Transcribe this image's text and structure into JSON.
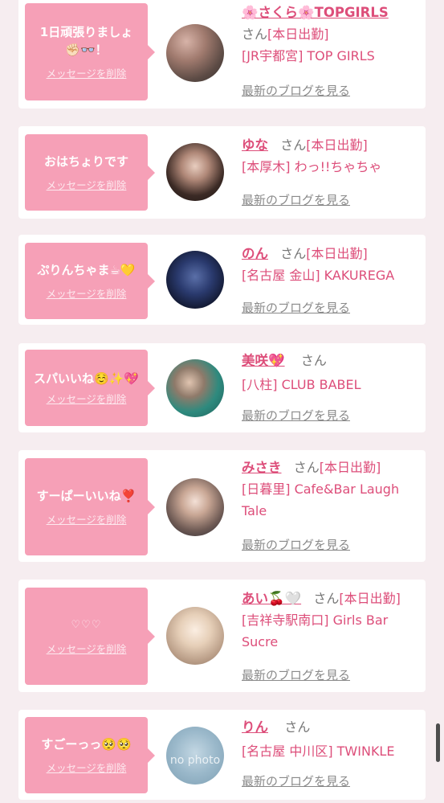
{
  "delete_label": "メッセージを削除",
  "blog_label": "最新のブログを見る",
  "san_label": "さん",
  "working_label": "[本日出勤]",
  "colors": {
    "bubble": "#f6a0b7",
    "accent": "#dd4e7a",
    "background": "#f6edf0"
  },
  "entries": [
    {
      "message": "1日頑張りましょ✊🏻👓！",
      "name": "🌸さくら🌸TOPGIRLS",
      "shop": "[JR宇都宮] TOP GIRLS"
    },
    {
      "message": "おはちょりです",
      "name": "ゆな",
      "shop": "[本厚木] わっ!!ちゃちゃ"
    },
    {
      "message": "ぷりんちゃま☕💛",
      "name": "のん",
      "shop": "[名古屋 金山] KAKUREGA"
    },
    {
      "message": "スパいいね☺️✨💖",
      "name": "美咲💖",
      "shop": "[八柱] CLUB BABEL"
    },
    {
      "message": "すーぱーいいね❣️",
      "name": "みさき",
      "shop": "[日暮里] Cafe&Bar Laugh Tale"
    },
    {
      "message": "♡♡♡",
      "name": "あい🍒🤍",
      "shop": "[吉祥寺駅南口] Girls Bar Sucre"
    },
    {
      "message": "すごーっっ🥺🥺",
      "name": "りん",
      "shop": "[名古屋 中川区] TWINKLE"
    }
  ],
  "no_photo_text": "no photo"
}
